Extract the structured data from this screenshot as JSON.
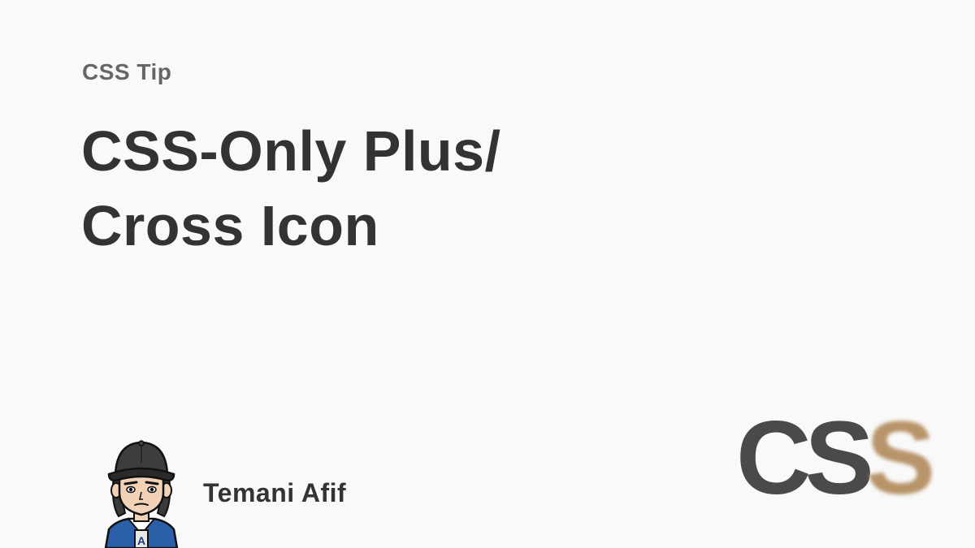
{
  "kicker": "CSS Tip",
  "title": {
    "line1": "CSS-Only Plus/",
    "line2": "Cross Icon"
  },
  "author": {
    "name": "Temani Afif",
    "avatar_icon": "cartoon-avatar-icon",
    "jacket_letter": "A"
  },
  "logo": {
    "letters": [
      "C",
      "S",
      "S"
    ],
    "dark_color": "#4a4a4a",
    "accent_color": "#b8946a"
  },
  "colors": {
    "background": "#f9f9f9",
    "text": "#333333",
    "kicker": "#666666"
  }
}
